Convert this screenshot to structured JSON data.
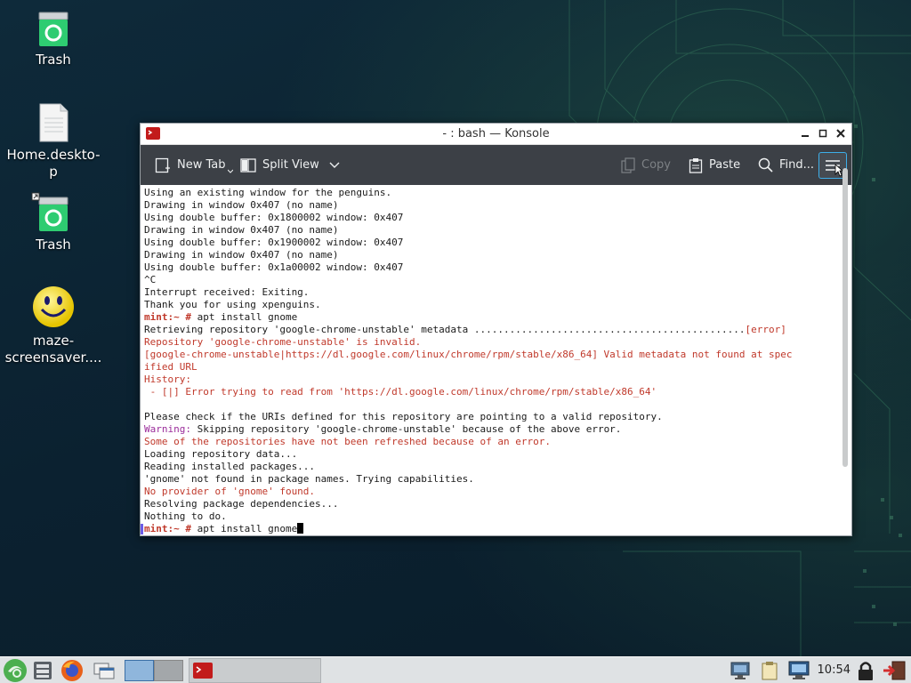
{
  "desktop": {
    "icons": [
      {
        "label": "Trash",
        "icon": "trash-icon"
      },
      {
        "label": "Home.deskto-p",
        "icon": "document-icon"
      },
      {
        "label": "Trash",
        "icon": "trash-icon"
      },
      {
        "label": "maze-screensaver....",
        "icon": "smiley-icon"
      }
    ]
  },
  "window": {
    "title": "- : bash — Konsole",
    "toolbar": {
      "new_tab": "New Tab",
      "split_view": "Split View",
      "copy": "Copy",
      "paste": "Paste",
      "find": "Find..."
    },
    "terminal_lines": [
      {
        "text": "Using an existing window for the penguins.",
        "style": ""
      },
      {
        "text": "Drawing in window 0x407 (no name)",
        "style": ""
      },
      {
        "text": "Using double buffer: 0x1800002 window: 0x407",
        "style": ""
      },
      {
        "text": "Drawing in window 0x407 (no name)",
        "style": ""
      },
      {
        "text": "Using double buffer: 0x1900002 window: 0x407",
        "style": ""
      },
      {
        "text": "Drawing in window 0x407 (no name)",
        "style": ""
      },
      {
        "text": "Using double buffer: 0x1a00002 window: 0x407",
        "style": ""
      },
      {
        "text": "^C",
        "style": ""
      },
      {
        "text": "Interrupt received: Exiting.",
        "style": ""
      },
      {
        "text": "Thank you for using xpenguins.",
        "style": ""
      },
      {
        "prompt": "mint:~ #",
        "text": " apt install gnome",
        "style": "prompt"
      },
      {
        "text": "Retrieving repository 'google-chrome-unstable' metadata ..............................................",
        "suffix": "[error]",
        "style": "suffix-red"
      },
      {
        "text": "Repository 'google-chrome-unstable' is invalid.",
        "style": "red"
      },
      {
        "text": "[google-chrome-unstable|https://dl.google.com/linux/chrome/rpm/stable/x86_64] Valid metadata not found at spec",
        "style": "red"
      },
      {
        "text": "ified URL",
        "style": "red"
      },
      {
        "text": "History:",
        "style": "red"
      },
      {
        "text": " - [|] Error trying to read from 'https://dl.google.com/linux/chrome/rpm/stable/x86_64'",
        "style": "red"
      },
      {
        "text": "",
        "style": ""
      },
      {
        "text": "Please check if the URIs defined for this repository are pointing to a valid repository.",
        "style": ""
      },
      {
        "prefix": "Warning:",
        "text": " Skipping repository 'google-chrome-unstable' because of the above error.",
        "style": "prefix-purple"
      },
      {
        "text": "Some of the repositories have not been refreshed because of an error.",
        "style": "red"
      },
      {
        "text": "Loading repository data...",
        "style": ""
      },
      {
        "text": "Reading installed packages...",
        "style": ""
      },
      {
        "text": "'gnome' not found in package names. Trying capabilities.",
        "style": ""
      },
      {
        "text": "No provider of 'gnome' found.",
        "style": "red"
      },
      {
        "text": "Resolving package dependencies...",
        "style": ""
      },
      {
        "text": "Nothing to do.",
        "style": ""
      },
      {
        "prompt": "mint:~ #",
        "text": " apt install gnome",
        "style": "prompt-cursor"
      }
    ]
  },
  "taskbar": {
    "clock": "10:54"
  },
  "colors": {
    "accent": "#3daee9",
    "error": "#c0392b",
    "warning": "#9b2d9b"
  }
}
